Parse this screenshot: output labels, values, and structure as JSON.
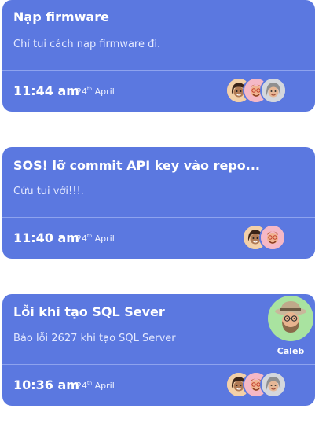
{
  "cards": [
    {
      "title": "Nạp firmware",
      "desc": "Chỉ tui cách nạp firmware đi.",
      "time": "11:44 am",
      "date_day": "24",
      "date_suffix": "th",
      "date_month": "April",
      "avatars": [
        "avatar-woman-dark-hair-icon",
        "avatar-man-glasses-icon",
        "avatar-woman-gray-hair-icon"
      ]
    },
    {
      "title": "SOS! lỡ commit API key vào repo...",
      "desc": "Cứu tui với!!!.",
      "time": "11:40 am",
      "date_day": "24",
      "date_suffix": "th",
      "date_month": "April",
      "avatars": [
        "avatar-woman-dark-hair-icon",
        "avatar-man-glasses-icon"
      ]
    },
    {
      "title": "Lỗi khi tạo SQL Sever",
      "desc": "Báo lỗi 2627 khi tạo SQL Server",
      "time": "10:36 am",
      "date_day": "24",
      "date_suffix": "th",
      "date_month": "April",
      "avatars": [
        "avatar-woman-dark-hair-icon",
        "avatar-man-glasses-icon",
        "avatar-woman-gray-hair-icon"
      ],
      "assignee": {
        "name": "Caleb",
        "icon": "avatar-man-hat-beard-icon"
      }
    }
  ],
  "colors": {
    "card": "#5b78e0",
    "divider": "#8ea3ee",
    "assignee_bg": "#a9e3a0"
  }
}
